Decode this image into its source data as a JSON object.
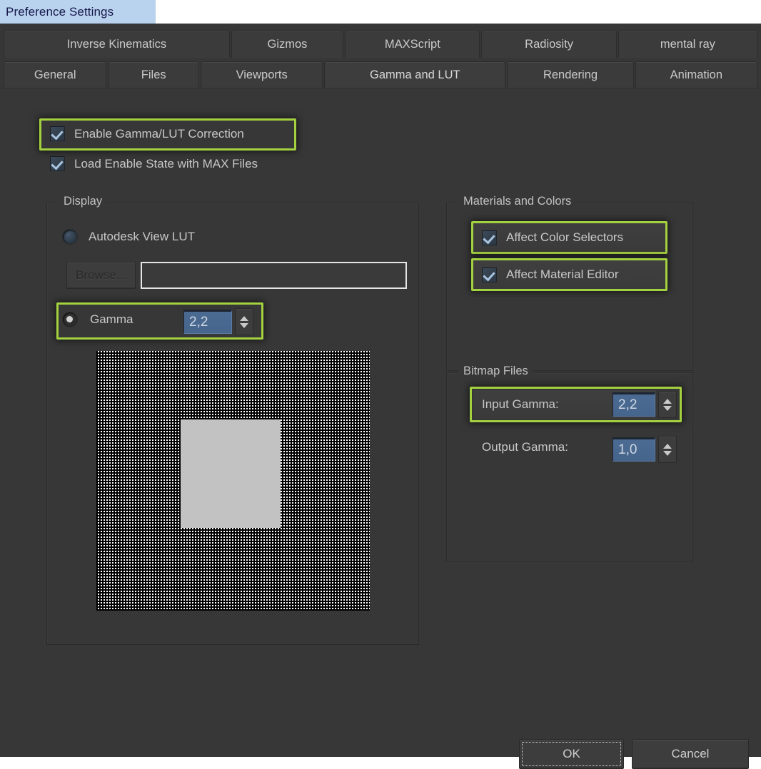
{
  "window": {
    "title": "Preference Settings"
  },
  "tabs": {
    "row_top": [
      {
        "label": "Inverse Kinematics",
        "active": false
      },
      {
        "label": "Gizmos",
        "active": false
      },
      {
        "label": "MAXScript",
        "active": false
      },
      {
        "label": "Radiosity",
        "active": false
      },
      {
        "label": "mental ray",
        "active": false
      }
    ],
    "row_bottom": [
      {
        "label": "General",
        "active": false
      },
      {
        "label": "Files",
        "active": false
      },
      {
        "label": "Viewports",
        "active": false
      },
      {
        "label": "Gamma and LUT",
        "active": true
      },
      {
        "label": "Rendering",
        "active": false
      },
      {
        "label": "Animation",
        "active": false
      }
    ]
  },
  "top_checkboxes": [
    {
      "label": "Enable Gamma/LUT Correction",
      "checked": true,
      "highlighted": true
    },
    {
      "label": "Load Enable State with MAX Files",
      "checked": true,
      "highlighted": false
    }
  ],
  "display_group": {
    "title": "Display",
    "lut_radio": {
      "label": "Autodesk View LUT",
      "selected": false
    },
    "browse_button": {
      "label": "Browse...",
      "enabled": false
    },
    "lut_path": {
      "value": "",
      "placeholder": ""
    },
    "gamma_radio": {
      "label": "Gamma",
      "selected": true,
      "highlighted": true
    },
    "gamma_value": "2,2"
  },
  "materials_group": {
    "title": "Materials and Colors",
    "checkboxes": [
      {
        "label": "Affect Color Selectors",
        "checked": true,
        "highlighted": true
      },
      {
        "label": "Affect Material Editor",
        "checked": true,
        "highlighted": true
      }
    ]
  },
  "bitmap_group": {
    "title": "Bitmap Files",
    "rows": [
      {
        "label": "Input Gamma:",
        "value": "2,2",
        "highlighted": true
      },
      {
        "label": "Output Gamma:",
        "value": "1,0",
        "highlighted": false
      }
    ]
  },
  "footer": {
    "ok_label": "OK",
    "cancel_label": "Cancel"
  },
  "colors": {
    "highlight": "#a3d13f",
    "dialog_bg": "#373737",
    "field_selected": "#4b6b93",
    "title_bar": "#b9d3ef"
  }
}
